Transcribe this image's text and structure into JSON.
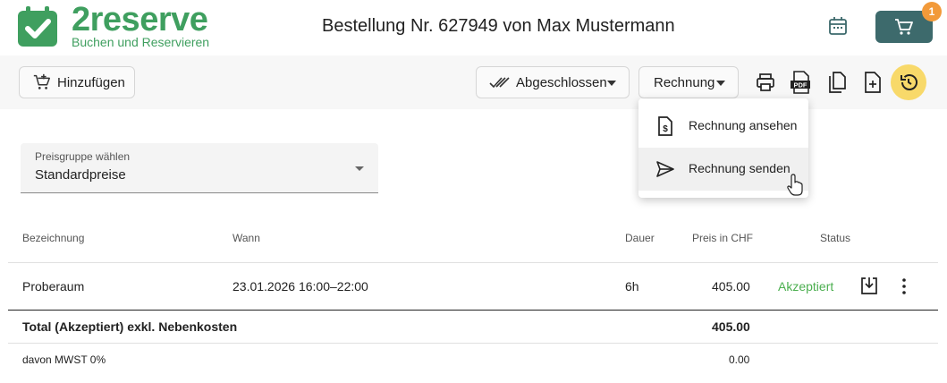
{
  "brand": {
    "name": "2reserve",
    "tagline": "Buchen und Reservieren"
  },
  "page_title": "Bestellung Nr. 627949 von Max Mustermann",
  "cart": {
    "count": "1"
  },
  "toolbar": {
    "add_label": "Hinzufügen",
    "status_label": "Abgeschlossen",
    "invoice_label": "Rechnung"
  },
  "invoice_menu": {
    "items": [
      {
        "label": "Rechnung ansehen",
        "icon": "invoice-document-icon"
      },
      {
        "label": "Rechnung senden",
        "icon": "send-icon"
      }
    ]
  },
  "price_group": {
    "label": "Preisgruppe wählen",
    "value": "Standardpreise"
  },
  "table": {
    "headers": {
      "name": "Bezeichnung",
      "when": "Wann",
      "duration": "Dauer",
      "price": "Preis in CHF",
      "status": "Status"
    },
    "rows": [
      {
        "name": "Proberaum",
        "when": "23.01.2026 16:00–22:00",
        "duration": "6h",
        "price": "405.00",
        "status": "Akzeptiert"
      }
    ],
    "total": {
      "label": "Total (Akzeptiert) exkl. Nebenkosten",
      "value": "405.00"
    },
    "vat": {
      "label": "davon MWST 0%",
      "value": "0.00"
    }
  },
  "colors": {
    "brand_green": "#3f9f5f",
    "cart_bg": "#3d6a6c",
    "badge": "#f29a3a",
    "history_bg": "#f8d96a",
    "accepted": "#4caf50"
  }
}
